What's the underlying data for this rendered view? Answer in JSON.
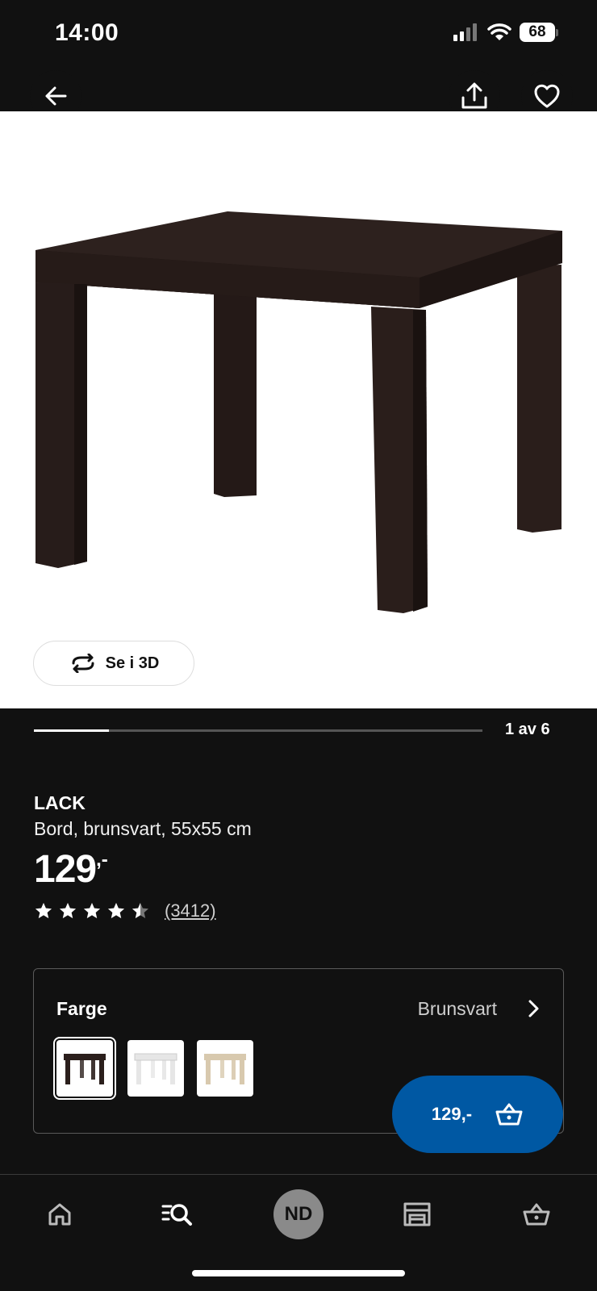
{
  "status_bar": {
    "time": "14:00",
    "battery": "68",
    "icons": [
      "cellular-signal-icon",
      "wifi-icon",
      "battery-icon"
    ]
  },
  "top_nav": {
    "icons": [
      "back-arrow-icon",
      "share-icon",
      "heart-icon"
    ]
  },
  "gallery": {
    "view_3d_label": "Se i 3D",
    "page_indicator": "1 av 6",
    "progress_fraction": 0.167
  },
  "product": {
    "name": "LACK",
    "description": "Bord, brunsvart, 55x55 cm",
    "price": "129",
    "price_suffix": ",-",
    "rating_stars": 4.5,
    "rating_count": "(3412)"
  },
  "color_selector": {
    "label": "Farge",
    "value": "Brunsvart",
    "swatches": [
      {
        "color": "#2b1f1c",
        "selected": true
      },
      {
        "color": "#f4f4f4",
        "selected": false
      },
      {
        "color": "#d8c9ae",
        "selected": false
      }
    ]
  },
  "cart_button": {
    "label": "129,-"
  },
  "bottom_nav": {
    "avatar_initials": "ND",
    "tabs": [
      "home-icon",
      "search-list-icon",
      "profile-avatar",
      "store-icon",
      "cart-icon"
    ]
  },
  "colors": {
    "background": "#111111",
    "accent_blue": "#0058a3",
    "table_brown": "#2b1f1c"
  }
}
